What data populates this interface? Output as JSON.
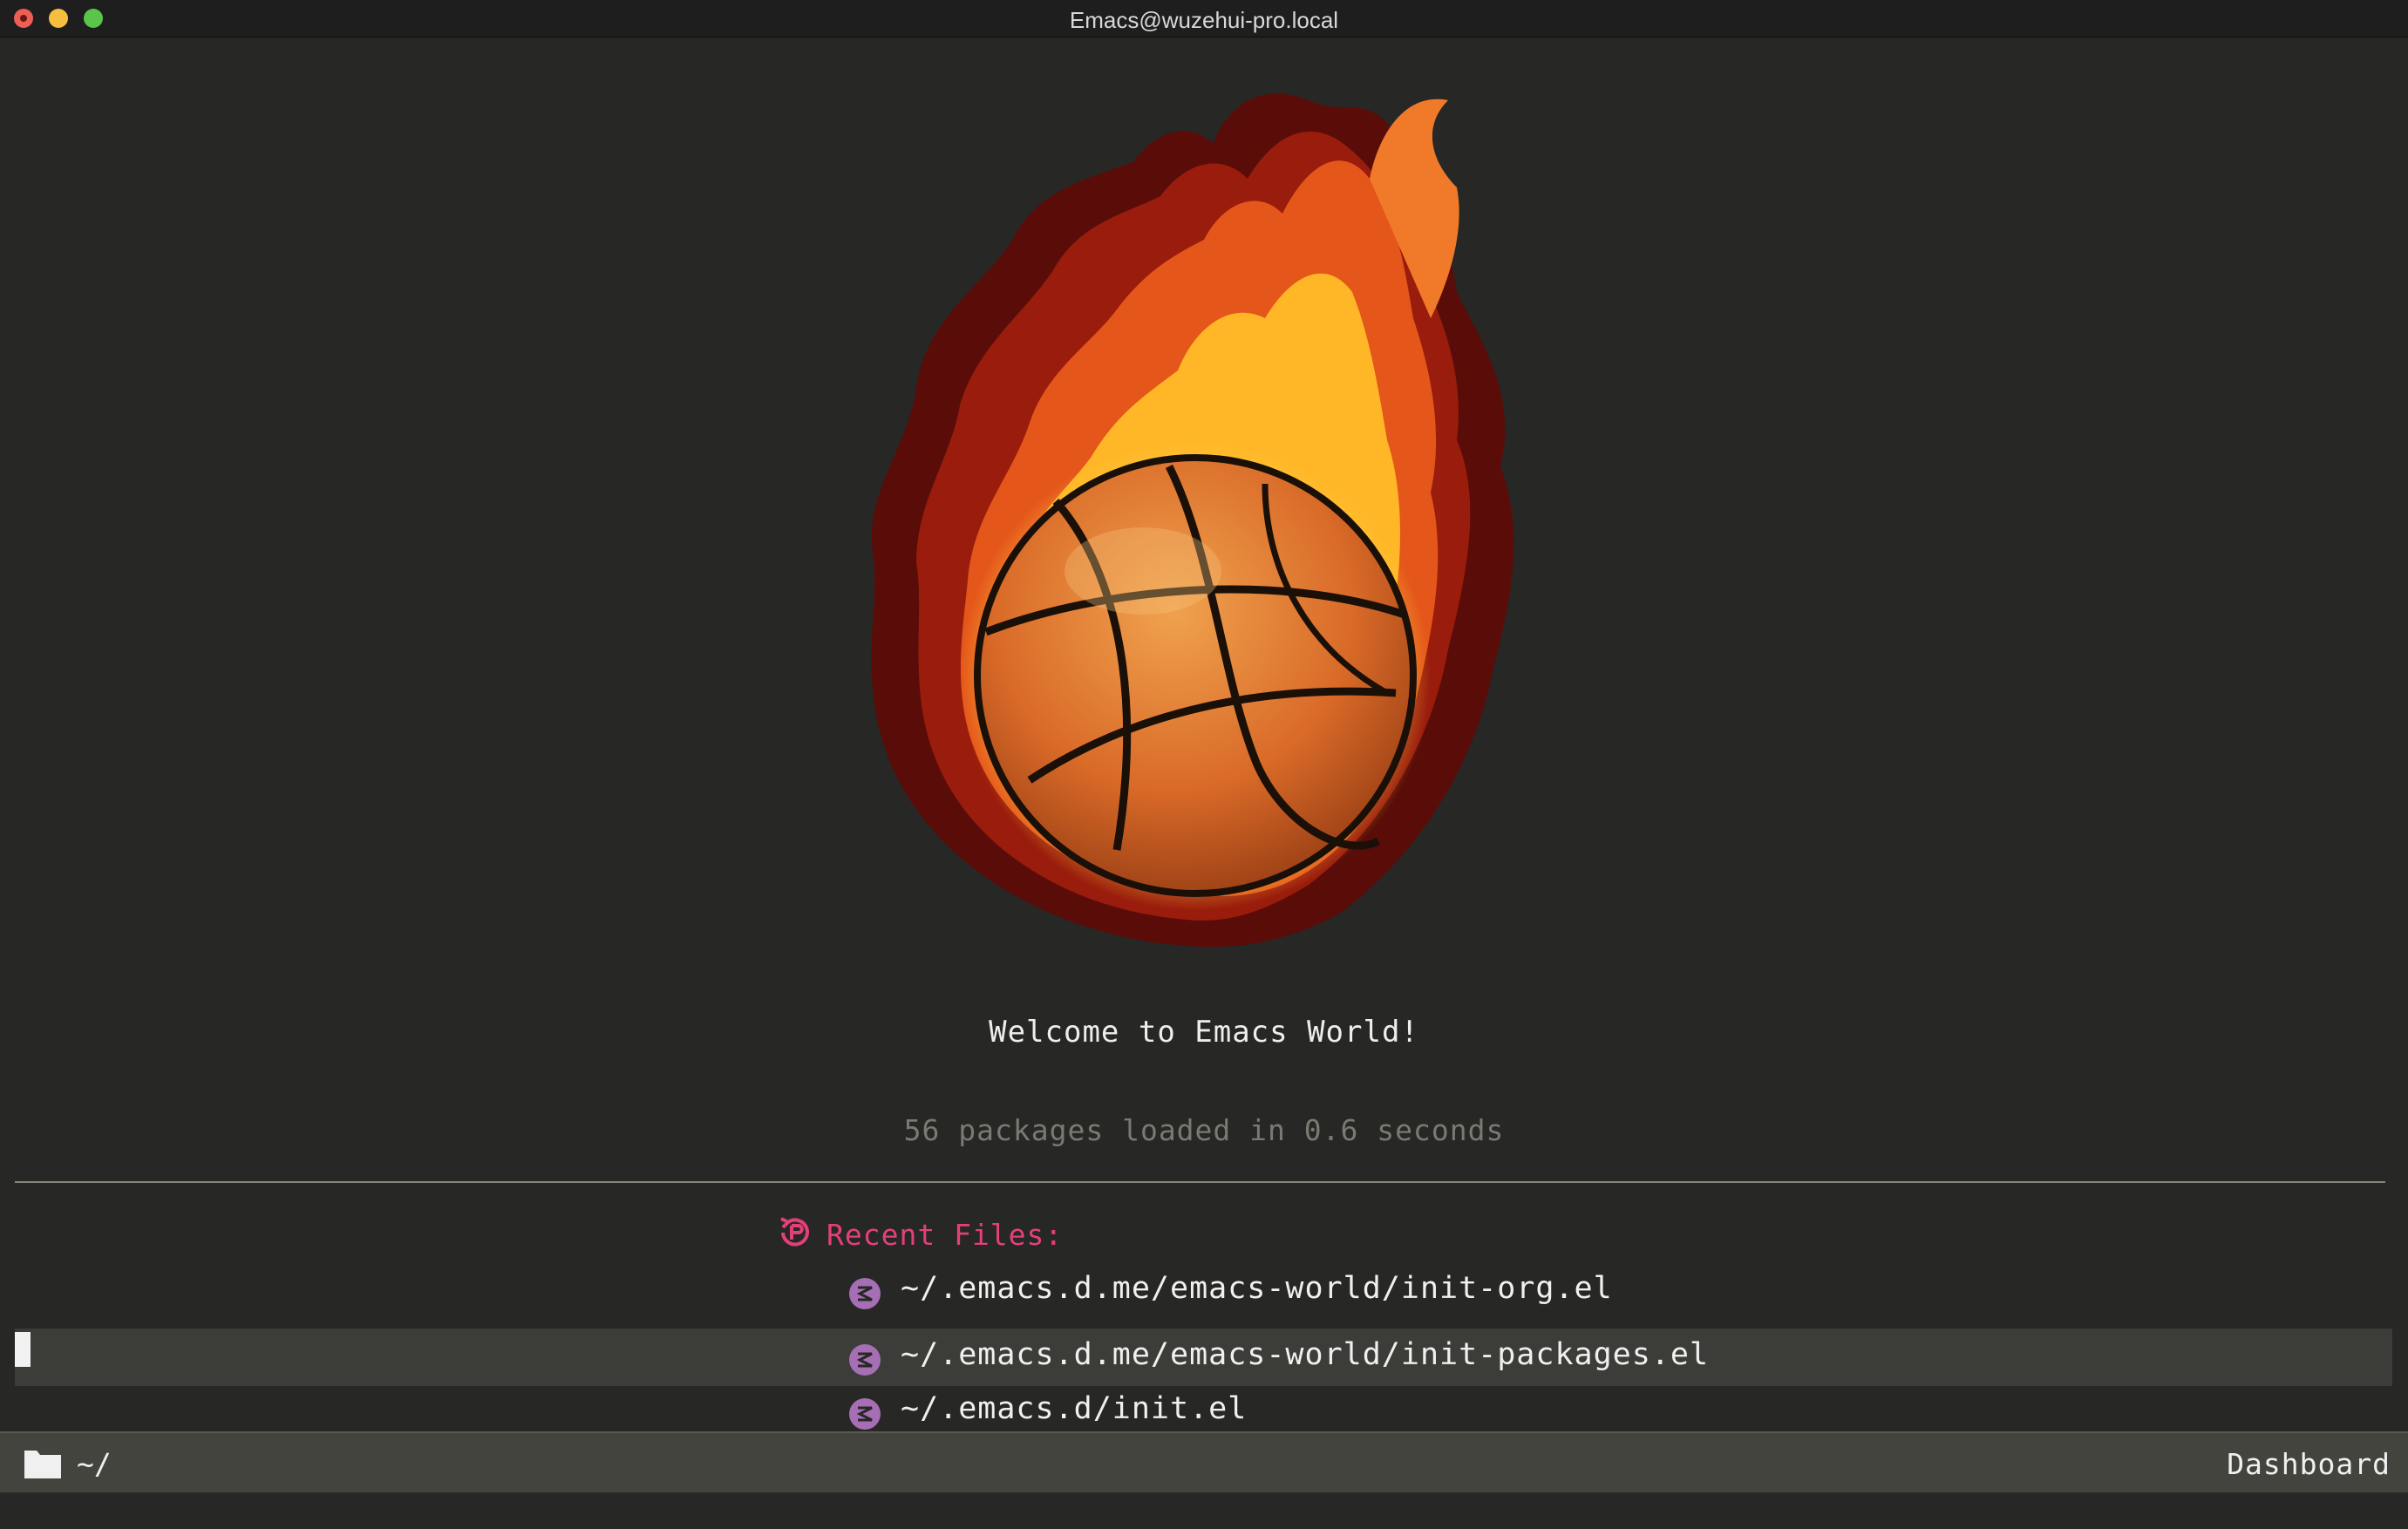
{
  "window": {
    "title": "Emacs@wuzehui-pro.local"
  },
  "dashboard": {
    "banner_icon": "flaming-basketball",
    "welcome": "Welcome to Emacs World!",
    "load_info": "56 packages loaded in 0.6 seconds",
    "recent_files": {
      "heading": "Recent Files:",
      "heading_icon": "history-icon",
      "item_icon": "emacs-icon",
      "items": [
        "~/.emacs.d.me/emacs-world/init-org.el",
        "~/.emacs.d.me/emacs-world/init-packages.el",
        "~/.emacs.d/init.el"
      ],
      "current_index": 1
    }
  },
  "modeline": {
    "dir": "~/",
    "mode": "Dashboard",
    "dir_icon": "folder-icon"
  },
  "colors": {
    "background": "#272725",
    "accent": "#e3407a",
    "emacs_icon": "#a66fb5",
    "modeline_bg": "#44443f"
  }
}
